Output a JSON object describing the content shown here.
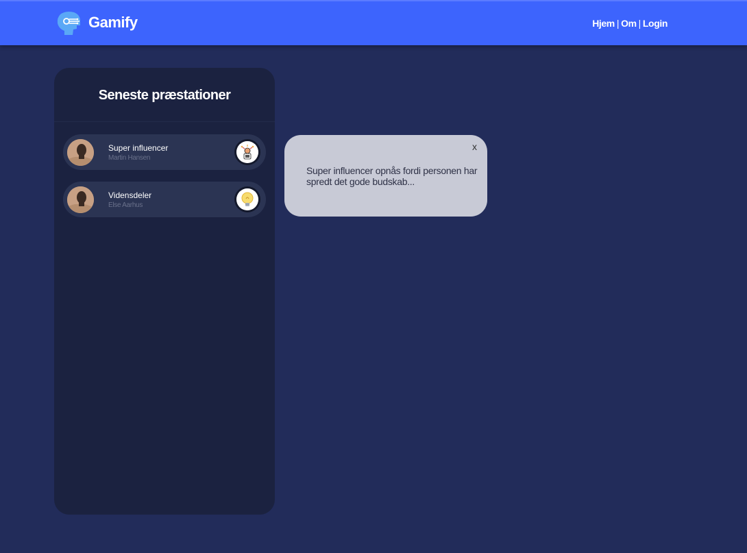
{
  "header": {
    "brand": "Gamify",
    "logo_icon": "robot-head-icon",
    "nav": [
      {
        "label": "Hjem"
      },
      {
        "label": "Om"
      },
      {
        "label": "Login"
      }
    ],
    "nav_separator": "|"
  },
  "panel": {
    "title": "Seneste præstationer",
    "items": [
      {
        "title": "Super influencer",
        "subtitle": "Martin Hansen",
        "badge_icon": "megaphone-person-icon"
      },
      {
        "title": "Vidensdeler",
        "subtitle": "Else Aarhus",
        "badge_icon": "lightbulb-icon"
      }
    ]
  },
  "popup": {
    "close_label": "x",
    "text": "Super influencer opnås fordi personen har spredt det gode budskab..."
  },
  "colors": {
    "header_bg": "#3d64fd",
    "page_bg": "#222c5a",
    "panel_bg": "#1b2240",
    "row_bg": "#2b3453",
    "popup_bg": "#c8cad6"
  }
}
